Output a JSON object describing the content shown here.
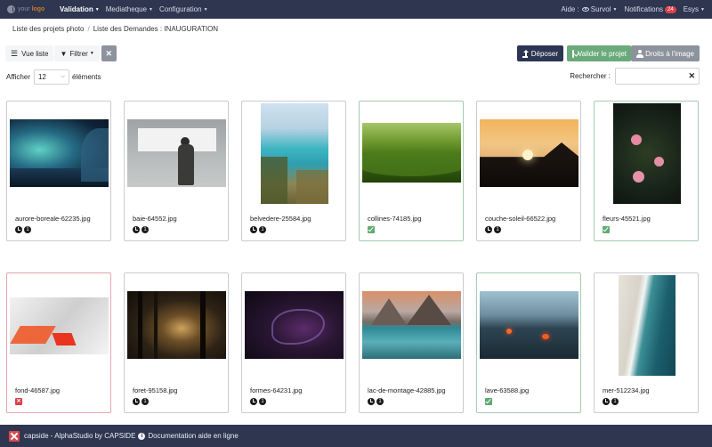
{
  "navbar": {
    "logo_text_prefix": "your ",
    "logo_text_brand": "logo",
    "menu": [
      {
        "label": "Validation",
        "active": true
      },
      {
        "label": "Mediatheque",
        "active": false
      },
      {
        "label": "Configuration",
        "active": false
      }
    ],
    "aide_label": "Aide :",
    "survol_label": "Survol",
    "notifications_label": "Notifications",
    "notifications_count": "24",
    "user_label": "Esys"
  },
  "breadcrumb": {
    "items": [
      "Liste des projets photo",
      "Liste des Demandes : INAUGURATION"
    ]
  },
  "toolbar": {
    "view_label": "Vue liste",
    "filter_label": "Filtrer",
    "clear_label": "✕",
    "deposit_label": "Déposer",
    "validate_label": "Valider le projet",
    "rights_label": "Droits à l'image"
  },
  "list_controls": {
    "show_label": "Afficher",
    "page_size": "12",
    "elements_label": "éléments",
    "search_label": "Rechercher :",
    "search_value": "",
    "search_clear": "✕"
  },
  "cards": [
    {
      "filename": "aurore-boreale-62235.jpg",
      "status": "pending",
      "count": "1"
    },
    {
      "filename": "baie-64552.jpg",
      "status": "pending",
      "count": "1"
    },
    {
      "filename": "belvedere-25584.jpg",
      "status": "pending",
      "count": "1"
    },
    {
      "filename": "collines-74185.jpg",
      "status": "validated",
      "count": ""
    },
    {
      "filename": "couche-soleil-66522.jpg",
      "status": "pending",
      "count": "1"
    },
    {
      "filename": "fleurs-45521.jpg",
      "status": "validated",
      "count": ""
    },
    {
      "filename": "fond-46587.jpg",
      "status": "rejected",
      "count": ""
    },
    {
      "filename": "foret-95158.jpg",
      "status": "pending",
      "count": "1"
    },
    {
      "filename": "formes-64231.jpg",
      "status": "pending",
      "count": "1"
    },
    {
      "filename": "lac-de-montage-42885.jpg",
      "status": "pending",
      "count": "1"
    },
    {
      "filename": "lave-63588.jpg",
      "status": "validated",
      "count": ""
    },
    {
      "filename": "mer-512234.jpg",
      "status": "pending",
      "count": "1"
    }
  ],
  "footer": {
    "brand_text": "capside - AlphaStudio by CAPSIDE",
    "doc_text": "Documentation aide en ligne"
  },
  "colors": {
    "navbar_bg": "#2e3650",
    "accent_dark": "#2c3654",
    "validate_green": "#6aaa7a",
    "rights_grey": "#8d939d",
    "notification_red": "#e0404b",
    "ok_green": "#5faa72",
    "ko_red": "#d9434f"
  }
}
